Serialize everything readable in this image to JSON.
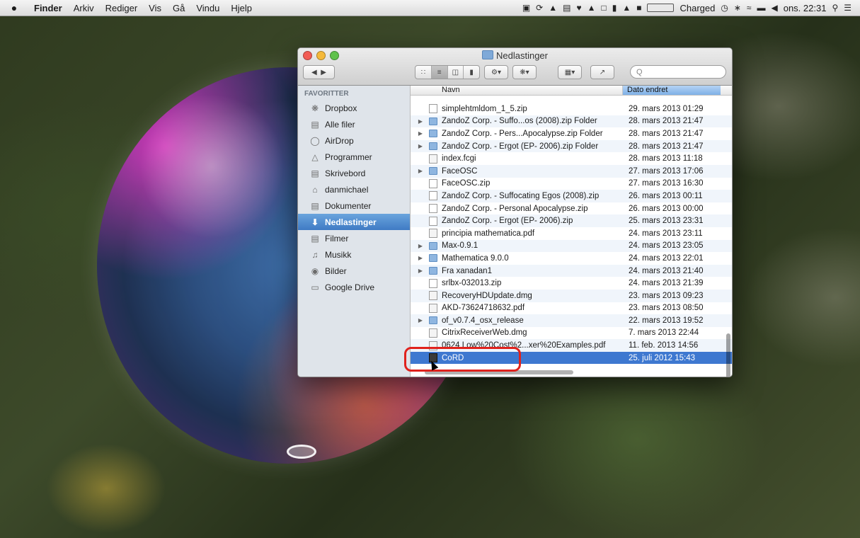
{
  "menubar": {
    "apple": "",
    "items": [
      "Finder",
      "Arkiv",
      "Rediger",
      "Vis",
      "Gå",
      "Vindu",
      "Hjelp"
    ],
    "battery_label": "Charged",
    "clock": "ons. 22:31"
  },
  "window": {
    "title": "Nedlastinger",
    "search_placeholder": "Q"
  },
  "sidebar": {
    "heading": "FAVORITTER",
    "items": [
      {
        "label": "Dropbox",
        "icon": "dropbox-icon"
      },
      {
        "label": "Alle filer",
        "icon": "all-files-icon"
      },
      {
        "label": "AirDrop",
        "icon": "airdrop-icon"
      },
      {
        "label": "Programmer",
        "icon": "applications-icon"
      },
      {
        "label": "Skrivebord",
        "icon": "desktop-icon"
      },
      {
        "label": "danmichael",
        "icon": "home-icon"
      },
      {
        "label": "Dokumenter",
        "icon": "documents-icon"
      },
      {
        "label": "Nedlastinger",
        "icon": "downloads-icon"
      },
      {
        "label": "Filmer",
        "icon": "movies-icon"
      },
      {
        "label": "Musikk",
        "icon": "music-icon"
      },
      {
        "label": "Bilder",
        "icon": "pictures-icon"
      },
      {
        "label": "Google Drive",
        "icon": "folder-icon"
      }
    ]
  },
  "filelist": {
    "col_name": "Navn",
    "col_date": "Dato endret",
    "rows": [
      {
        "name": "simplehtmldom_1_5.zip",
        "date": "29. mars 2013 01:29",
        "kind": "zip"
      },
      {
        "name": "ZandoZ Corp. - Suffo...os (2008).zip Folder",
        "date": "28. mars 2013 21:47",
        "kind": "folder"
      },
      {
        "name": "ZandoZ Corp. - Pers...Apocalypse.zip Folder",
        "date": "28. mars 2013 21:47",
        "kind": "folder"
      },
      {
        "name": "ZandoZ Corp. - Ergot (EP- 2006).zip Folder",
        "date": "28. mars 2013 21:47",
        "kind": "folder"
      },
      {
        "name": "index.fcgi",
        "date": "28. mars 2013 11:18",
        "kind": "doc"
      },
      {
        "name": "FaceOSC",
        "date": "27. mars 2013 17:06",
        "kind": "folder"
      },
      {
        "name": "FaceOSC.zip",
        "date": "27. mars 2013 16:30",
        "kind": "zip"
      },
      {
        "name": "ZandoZ Corp. - Suffocating Egos (2008).zip",
        "date": "26. mars 2013 00:11",
        "kind": "zip"
      },
      {
        "name": "ZandoZ Corp. - Personal Apocalypse.zip",
        "date": "26. mars 2013 00:00",
        "kind": "zip"
      },
      {
        "name": "ZandoZ Corp. - Ergot (EP- 2006).zip",
        "date": "25. mars 2013 23:31",
        "kind": "zip"
      },
      {
        "name": "principia mathematica.pdf",
        "date": "24. mars 2013 23:11",
        "kind": "doc"
      },
      {
        "name": "Max-0.9.1",
        "date": "24. mars 2013 23:05",
        "kind": "folder"
      },
      {
        "name": "Mathematica 9.0.0",
        "date": "24. mars 2013 22:01",
        "kind": "folder"
      },
      {
        "name": "Fra xanadan1",
        "date": "24. mars 2013 21:40",
        "kind": "folder"
      },
      {
        "name": "srlbx-032013.zip",
        "date": "24. mars 2013 21:39",
        "kind": "zip"
      },
      {
        "name": "RecoveryHDUpdate.dmg",
        "date": "23. mars 2013 09:23",
        "kind": "doc"
      },
      {
        "name": "AKD-73624718632.pdf",
        "date": "23. mars 2013 08:50",
        "kind": "doc"
      },
      {
        "name": "of_v0.7.4_osx_release",
        "date": "22. mars 2013 19:52",
        "kind": "folder"
      },
      {
        "name": "CitrixReceiverWeb.dmg",
        "date": "7. mars 2013 22:44",
        "kind": "doc"
      },
      {
        "name": "0624 Low%20Cost%2...xer%20Examples.pdf",
        "date": "11. feb. 2013 14:56",
        "kind": "doc"
      },
      {
        "name": "CoRD",
        "date": "25. juli 2012 15:43",
        "kind": "app"
      }
    ]
  }
}
